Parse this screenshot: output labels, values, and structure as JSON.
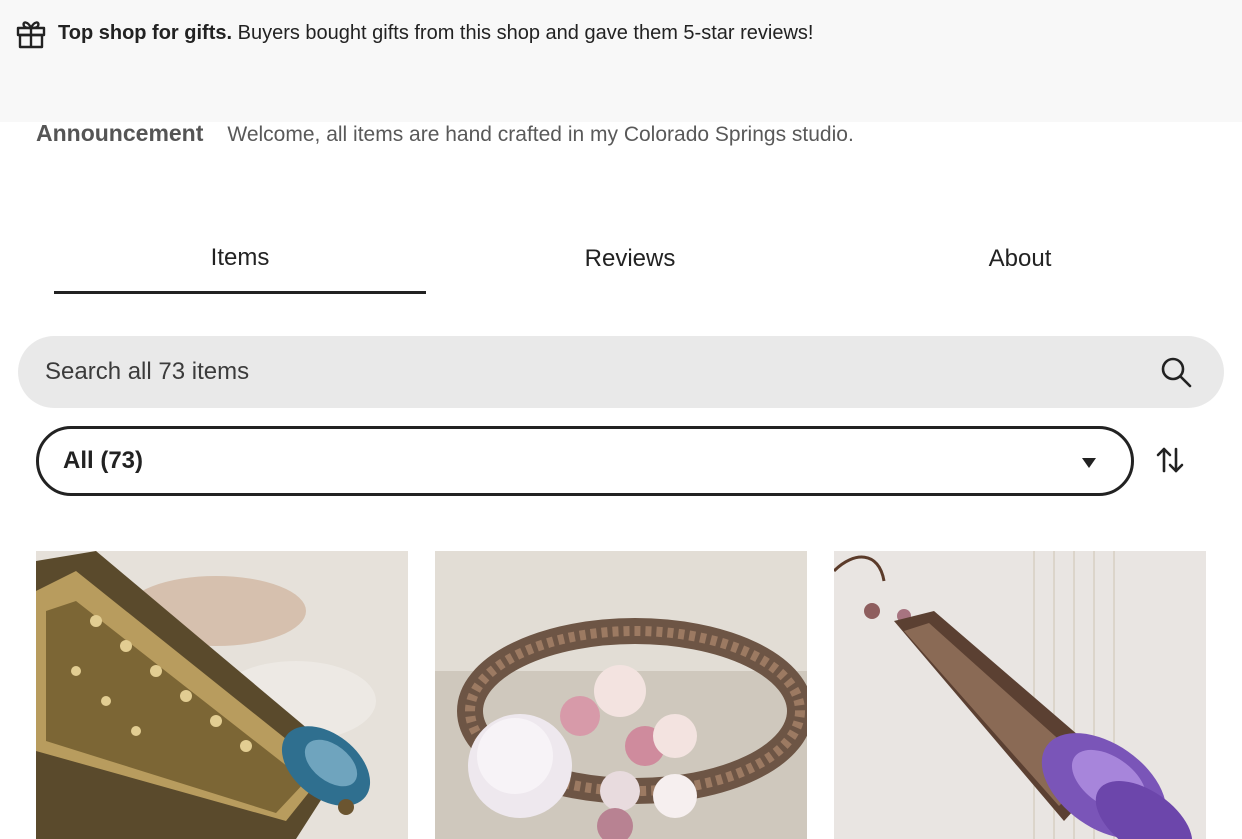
{
  "banner": {
    "bold": "Top shop for gifts.",
    "text": "Buyers bought gifts from this shop and gave them 5-star reviews!",
    "icon": "gift-icon"
  },
  "announcement": {
    "label": "Announcement",
    "message": "Welcome, all items are hand crafted in my Colorado Springs studio."
  },
  "tabs": [
    {
      "label": "Items",
      "active": true
    },
    {
      "label": "Reviews",
      "active": false
    },
    {
      "label": "About",
      "active": false
    }
  ],
  "search": {
    "placeholder": "Search all 73 items",
    "icon": "search-icon"
  },
  "filter": {
    "selected": "All (73)",
    "caret_icon": "caret-down-icon",
    "sort_icon": "sort-arrows-icon"
  },
  "products": [
    {
      "description": "antique brass filigree cone earring with blue crystal teardrop"
    },
    {
      "description": "copper wire-wrapped ring with rose quartz and pink bead cluster"
    },
    {
      "description": "copper filigree cone earrings with purple amethyst teardrops"
    }
  ],
  "colors": {
    "banner_bg": "#f8f8f8",
    "search_bg": "#e9e9e9",
    "text": "#222222",
    "muted": "#595959"
  }
}
